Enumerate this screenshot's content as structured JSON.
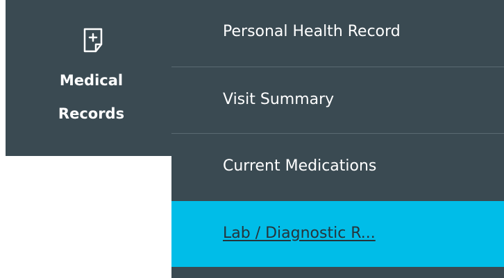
{
  "nav_tile": {
    "icon": "add-note-icon",
    "label_line1": "Medical",
    "label_line2": "Records"
  },
  "submenu": {
    "items": [
      {
        "label": "Personal Health Record",
        "active": false
      },
      {
        "label": "Visit Summary",
        "active": false
      },
      {
        "label": "Current Medications",
        "active": false
      },
      {
        "label": "Lab / Diagnostic R...",
        "active": true
      }
    ]
  },
  "colors": {
    "menu_bg": "#3a4a52",
    "active_bg": "#00bde8",
    "text": "#ffffff",
    "divider": "#5a6a72"
  }
}
